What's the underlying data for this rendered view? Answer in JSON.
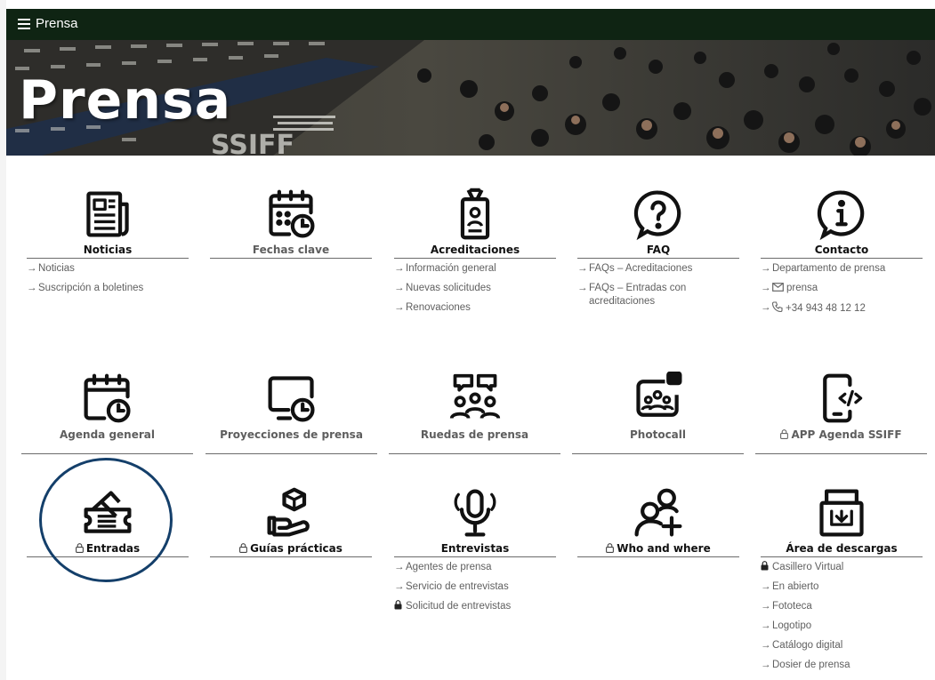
{
  "topbar": {
    "menu_label": "Prensa"
  },
  "banner": {
    "title": "Prensa"
  },
  "row1": [
    {
      "title": "Noticias",
      "icon": "newspaper-icon",
      "muted": false,
      "links": [
        {
          "label": "Noticias",
          "marker": "arrow"
        },
        {
          "label": "Suscripción a boletines",
          "marker": "arrow"
        }
      ]
    },
    {
      "title": "Fechas clave",
      "icon": "calendar-clock-icon",
      "muted": true,
      "links": []
    },
    {
      "title": "Acreditaciones",
      "icon": "badge-icon",
      "muted": false,
      "links": [
        {
          "label": "Información general",
          "marker": "arrow"
        },
        {
          "label": "Nuevas solicitudes",
          "marker": "arrow"
        },
        {
          "label": "Renovaciones",
          "marker": "arrow"
        }
      ]
    },
    {
      "title": "FAQ",
      "icon": "question-bubble-icon",
      "muted": false,
      "links": [
        {
          "label": "FAQs – Acreditaciones",
          "marker": "arrow"
        },
        {
          "label": "FAQs – Entradas con acreditaciones",
          "marker": "arrow"
        }
      ]
    },
    {
      "title": "Contacto",
      "icon": "info-bubble-icon",
      "muted": false,
      "links": [
        {
          "label": "Departamento de prensa",
          "marker": "arrow"
        },
        {
          "label": "prensa",
          "marker": "arrow",
          "inline_icon": "email-icon"
        },
        {
          "label": "+34 943 48 12 12",
          "marker": "arrow",
          "inline_icon": "phone-icon"
        }
      ]
    }
  ],
  "row2": [
    {
      "title": "Agenda general",
      "icon": "calendar-clock-icon"
    },
    {
      "title": "Proyecciones de prensa",
      "icon": "screen-clock-icon"
    },
    {
      "title": "Ruedas de prensa",
      "icon": "people-chat-icon"
    },
    {
      "title": "Photocall",
      "icon": "camera-group-icon"
    },
    {
      "title": "APP Agenda SSIFF",
      "icon": "phone-code-icon",
      "locked": true
    }
  ],
  "row3": [
    {
      "title": "Entradas",
      "icon": "tickets-icon",
      "locked": true,
      "links": []
    },
    {
      "title": "Guías prácticas",
      "icon": "hand-cube-icon",
      "locked": true,
      "links": []
    },
    {
      "title": "Entrevistas",
      "icon": "microphone-icon",
      "locked": false,
      "links": [
        {
          "label": "Agentes de prensa",
          "marker": "arrow"
        },
        {
          "label": "Servicio de entrevistas",
          "marker": "arrow"
        },
        {
          "label": "Solicitud de entrevistas",
          "marker": "lock"
        }
      ]
    },
    {
      "title": "Who and where",
      "icon": "add-user-icon",
      "locked": true,
      "links": []
    },
    {
      "title": "Área de descargas",
      "icon": "download-box-icon",
      "locked": false,
      "links": [
        {
          "label": "Casillero Virtual",
          "marker": "lock"
        },
        {
          "label": "En abierto",
          "marker": "arrow"
        },
        {
          "label": "Fototeca",
          "marker": "arrow"
        },
        {
          "label": "Logotipo",
          "marker": "arrow"
        },
        {
          "label": "Catálogo digital",
          "marker": "arrow"
        },
        {
          "label": "Dosier de prensa",
          "marker": "arrow"
        }
      ]
    }
  ],
  "colors": {
    "topbar": "#0f2413",
    "annotation_circle": "#143f6a",
    "link_text": "#606060"
  }
}
